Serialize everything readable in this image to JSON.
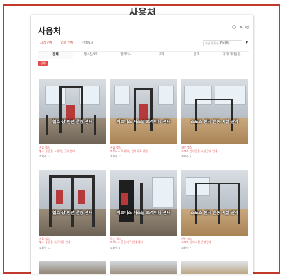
{
  "caption": "사용처",
  "page": {
    "title": "사용처",
    "header_links": [
      "○",
      "로그인"
    ],
    "filters": {
      "region_selected": "지역 전체",
      "type_selected": "업종 전체",
      "extra": "전체보기",
      "sort_label": "인기순",
      "sort_value": "최신 등록순으로 정렬",
      "dropdown_icon": "chevron-down-icon"
    },
    "tabs": [
      "전체",
      "헬스장/PT",
      "필라테스",
      "요가",
      "골프",
      "기타/기타운동"
    ],
    "badge": "전체"
  },
  "cards": [
    {
      "overlay": "헬스 장 안전 운영 센터",
      "category": "서울 헬스",
      "name": "헬스 장 운동 스테이션 관리 센터",
      "views": "조회수 14"
    },
    {
      "overlay": "피트니스 퍼스널 트레이닝 센터",
      "category": "서울 헬스",
      "name": "피트니스 트레이닝 센터 무료 상담",
      "views": "조회수 11"
    },
    {
      "overlay": "스포츠 센터 운동 시설 관리",
      "category": "경기 헬스",
      "name": "스포츠 센터 운동 시설 관리 안내",
      "views": "조회수 9"
    },
    {
      "overlay": "헬스 장 안전 운영 센터",
      "category": "서울 헬스",
      "name": "헬스 장 운동 기구 이용 안내",
      "views": "조회수 12"
    },
    {
      "overlay": "피트니스 퍼스널 트레이닝 센터",
      "category": "경기 헬스",
      "name": "피트니스 운동 기구 안내 센터",
      "views": "조회수 8"
    },
    {
      "overlay": "스포츠 센터 운동 시설 관리",
      "category": "인천 헬스",
      "name": "스포츠 센터 시설 운영 안내",
      "views": "조회수 7"
    }
  ]
}
